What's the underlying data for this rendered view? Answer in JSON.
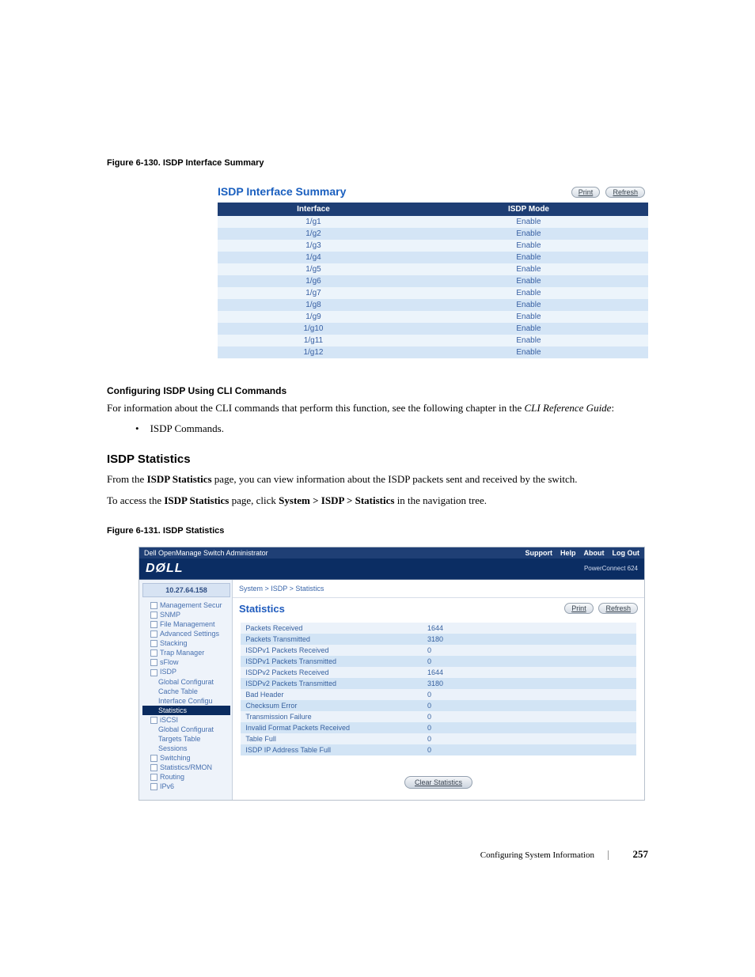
{
  "fig1": {
    "label": "Figure 6-130.    ISDP Interface Summary",
    "title": "ISDP Interface Summary",
    "print": "Print",
    "refresh": "Refresh",
    "col1": "Interface",
    "col2": "ISDP Mode",
    "rows": [
      {
        "if": "1/g1",
        "mode": "Enable"
      },
      {
        "if": "1/g2",
        "mode": "Enable"
      },
      {
        "if": "1/g3",
        "mode": "Enable"
      },
      {
        "if": "1/g4",
        "mode": "Enable"
      },
      {
        "if": "1/g5",
        "mode": "Enable"
      },
      {
        "if": "1/g6",
        "mode": "Enable"
      },
      {
        "if": "1/g7",
        "mode": "Enable"
      },
      {
        "if": "1/g8",
        "mode": "Enable"
      },
      {
        "if": "1/g9",
        "mode": "Enable"
      },
      {
        "if": "1/g10",
        "mode": "Enable"
      },
      {
        "if": "1/g11",
        "mode": "Enable"
      },
      {
        "if": "1/g12",
        "mode": "Enable"
      }
    ]
  },
  "text": {
    "cli_head": "Configuring ISDP Using CLI Commands",
    "cli_p_a": "For information about the CLI commands that perform this function, see the following chapter in the ",
    "cli_p_b": "CLI Reference Guide",
    "cli_p_c": ":",
    "bullet1": "ISDP Commands.",
    "sec_head": "ISDP Statistics",
    "sec_p1_a": "From the ",
    "sec_p1_b": "ISDP Statistics",
    "sec_p1_c": " page, you can view information about the ISDP packets sent and received by the switch.",
    "sec_p2_a": "To access the ",
    "sec_p2_b": "ISDP Statistics",
    "sec_p2_c": " page, click ",
    "sec_p2_d": "System > ISDP > Statistics",
    "sec_p2_e": " in the navigation tree."
  },
  "fig2": {
    "label": "Figure 6-131.    ISDP Statistics",
    "topbar_title": "Dell OpenManage Switch Administrator",
    "topbar_links": [
      "Support",
      "Help",
      "About",
      "Log Out"
    ],
    "brand": "DØLL",
    "brand_sub": "PowerConnect 624",
    "ip": "10.27.64.158",
    "crumbs": "System > ISDP > Statistics",
    "nav": [
      {
        "txt": "Management Secur",
        "cls": "nav-plus"
      },
      {
        "txt": "SNMP",
        "cls": "nav-plus"
      },
      {
        "txt": "File Management",
        "cls": "nav-plus"
      },
      {
        "txt": "Advanced Settings",
        "cls": "nav-plus"
      },
      {
        "txt": "Stacking",
        "cls": "nav-plus"
      },
      {
        "txt": "Trap Manager",
        "cls": "nav-plus"
      },
      {
        "txt": "sFlow",
        "cls": "nav-plus"
      },
      {
        "txt": "ISDP",
        "cls": "nav-minus"
      },
      {
        "txt": "Global Configurat",
        "cls": "sub"
      },
      {
        "txt": "Cache Table",
        "cls": "sub"
      },
      {
        "txt": "Interface Configu",
        "cls": "sub"
      },
      {
        "txt": "Statistics",
        "cls": "sub sel"
      },
      {
        "txt": "iSCSI",
        "cls": "nav-minus"
      },
      {
        "txt": "Global Configurat",
        "cls": "sub"
      },
      {
        "txt": "Targets Table",
        "cls": "sub"
      },
      {
        "txt": "Sessions",
        "cls": "sub"
      },
      {
        "txt": "Switching",
        "cls": "nav-plus sub2top"
      },
      {
        "txt": "Statistics/RMON",
        "cls": "nav-plus"
      },
      {
        "txt": "Routing",
        "cls": "nav-plus"
      },
      {
        "txt": "IPv6",
        "cls": "nav-plus"
      }
    ],
    "stats_title": "Statistics",
    "print": "Print",
    "refresh": "Refresh",
    "rows": [
      {
        "k": "Packets Received",
        "v": "1644"
      },
      {
        "k": "Packets Transmitted",
        "v": "3180"
      },
      {
        "k": "ISDPv1 Packets Received",
        "v": "0"
      },
      {
        "k": "ISDPv1 Packets Transmitted",
        "v": "0"
      },
      {
        "k": "ISDPv2 Packets Received",
        "v": "1644"
      },
      {
        "k": "ISDPv2 Packets Transmitted",
        "v": "3180"
      },
      {
        "k": "Bad Header",
        "v": "0"
      },
      {
        "k": "Checksum Error",
        "v": "0"
      },
      {
        "k": "Transmission Failure",
        "v": "0"
      },
      {
        "k": "Invalid Format Packets Received",
        "v": "0"
      },
      {
        "k": "Table Full",
        "v": "0"
      },
      {
        "k": "ISDP IP Address Table Full",
        "v": "0"
      }
    ],
    "clear_btn": "Clear Statistics"
  },
  "footer": {
    "section": "Configuring System Information",
    "page": "257"
  }
}
